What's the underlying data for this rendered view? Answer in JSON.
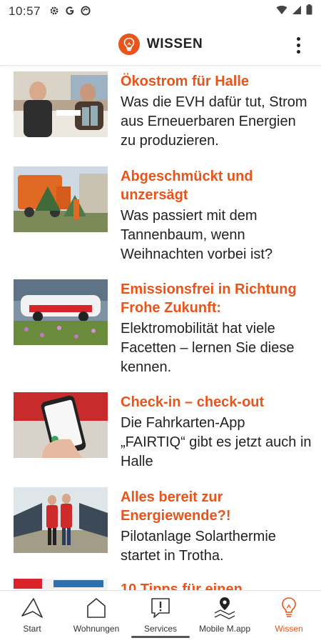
{
  "status_bar": {
    "time": "10:57",
    "icons_left": [
      "settings-icon",
      "google-icon",
      "sync-icon"
    ],
    "icons_right": [
      "wifi-icon",
      "signal-icon",
      "battery-icon"
    ]
  },
  "app_bar": {
    "title": "WISSEN",
    "logo_icon": "lightbulb-icon",
    "menu_icon": "more-vert-icon"
  },
  "colors": {
    "accent": "#e8541c",
    "text": "#222222"
  },
  "articles": [
    {
      "title": "Ökostrom für Halle",
      "description": "Was die EVH dafür tut, Strom aus Erneuerbaren Energien zu produzieren."
    },
    {
      "title": "Abgeschmückt und unzersägt",
      "description": "Was passiert mit dem Tannenbaum, wenn Weihnachten vorbei ist?"
    },
    {
      "title": "Emissionsfrei in Richtung Frohe Zukunft:",
      "description": "Elektromobilität hat viele Facetten – lernen Sie diese kennen."
    },
    {
      "title": "Check-in – check-out",
      "description": "Die Fahrkarten-App „FAIRTIQ“ gibt es jetzt auch in Halle"
    },
    {
      "title": "Alles bereit zur Energiewende?!",
      "description": "Pilotanlage Solarthermie startet in Trotha."
    },
    {
      "title": "10 Tipps für einen",
      "description": ""
    }
  ],
  "bottom_nav": {
    "items": [
      {
        "label": "Start",
        "icon": "triangle-icon",
        "active": false
      },
      {
        "label": "Wohnungen",
        "icon": "house-icon",
        "active": false
      },
      {
        "label": "Services",
        "icon": "chat-alert-icon",
        "active": false
      },
      {
        "label": "Mobile M.app",
        "icon": "map-pin-icon",
        "active": false
      },
      {
        "label": "Wissen",
        "icon": "lightbulb-icon",
        "active": true
      }
    ]
  }
}
